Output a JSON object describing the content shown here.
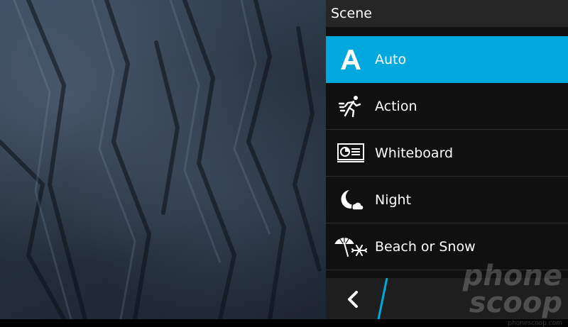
{
  "viewfinder": {
    "description_icon": "camera-viewfinder"
  },
  "panel": {
    "title": "Scene",
    "items": [
      {
        "label": "Auto",
        "icon": "auto-a-icon",
        "selected": true
      },
      {
        "label": "Action",
        "icon": "running-person-icon",
        "selected": false
      },
      {
        "label": "Whiteboard",
        "icon": "whiteboard-icon",
        "selected": false
      },
      {
        "label": "Night",
        "icon": "moon-cloud-icon",
        "selected": false
      },
      {
        "label": "Beach or Snow",
        "icon": "umbrella-snowflake-icon",
        "selected": false
      }
    ]
  },
  "actionbar": {
    "back_icon": "chevron-left-icon"
  },
  "watermark": {
    "line1": "phone",
    "line2": "scoop",
    "url": "phonescoop.com"
  },
  "colors": {
    "accent": "#00a8de",
    "panel_bg": "#101010",
    "header_bg": "#262626"
  }
}
